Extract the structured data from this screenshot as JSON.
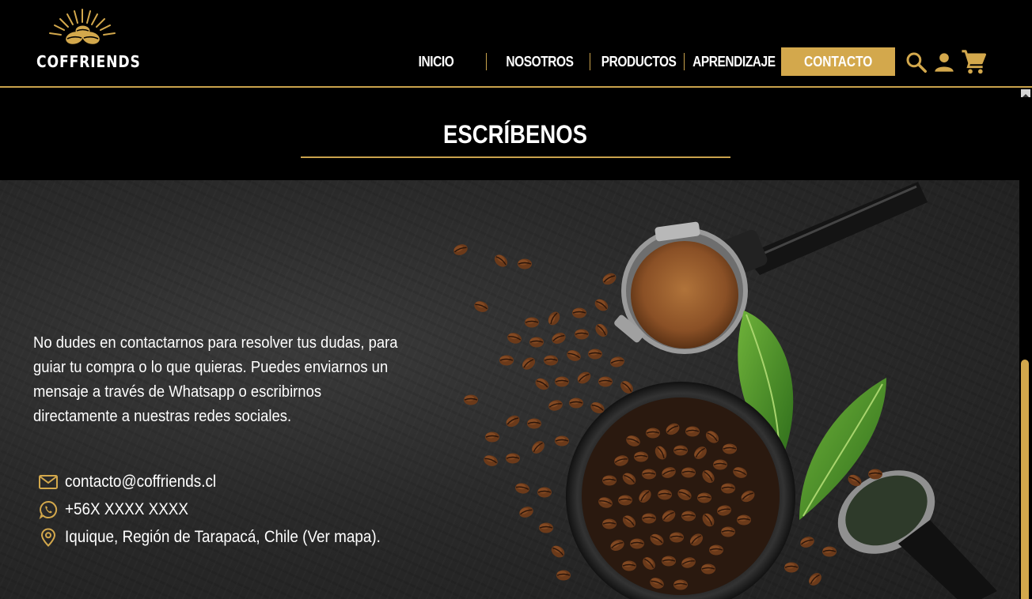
{
  "brand": {
    "name": "COFFRIENDS",
    "logo_icon": "coffee-beans-sunburst-icon"
  },
  "nav": {
    "items": [
      {
        "label": "INICIO"
      },
      {
        "label": "NOSOTROS"
      },
      {
        "label": "PRODUCTOS"
      },
      {
        "label": "APRENDIZAJE"
      }
    ],
    "cta_label": "CONTACTO",
    "icons": [
      "search-icon",
      "user-icon",
      "cart-icon"
    ]
  },
  "section": {
    "title": "ESCRÍBENOS"
  },
  "intro": "No dudes en contactarnos para resolver tus dudas, para guiar tu compra o lo que quieras. Puedes enviarnos un mensaje a través de Whatsapp o escribirnos directamente a nuestras redes sociales.",
  "contact": {
    "email": "contacto@coffriends.cl",
    "phone": "+56X XXXX XXXX",
    "address": "Iquique, Región de Tarapacá, Chile (Ver mapa)."
  },
  "colors": {
    "accent": "#d3a84c",
    "background": "#000000",
    "text": "#ffffff"
  }
}
